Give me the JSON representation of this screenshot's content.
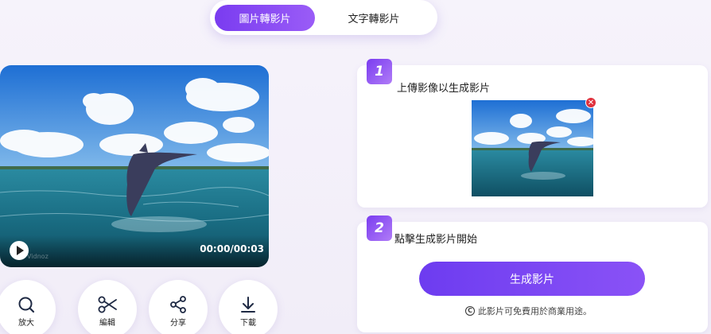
{
  "tabs": [
    {
      "label": "圖片轉影片",
      "active": true
    },
    {
      "label": "文字轉影片",
      "active": false
    }
  ],
  "video": {
    "timecode": "00:00/00:03",
    "watermark": "Vidnoz"
  },
  "actions": [
    {
      "label": "放大",
      "icon": "zoom-icon"
    },
    {
      "label": "編輯",
      "icon": "scissors-icon"
    },
    {
      "label": "分享",
      "icon": "share-icon"
    },
    {
      "label": "下載",
      "icon": "download-icon"
    }
  ],
  "step1": {
    "number": "1",
    "title": "上傳影像以生成影片",
    "remove_symbol": "✕"
  },
  "step2": {
    "number": "2",
    "title": "點擊生成影片開始",
    "button_label": "生成影片",
    "notice": "此影片可免費用於商業用途。",
    "copyright_symbol": "C"
  },
  "colors": {
    "accent": "#7a3cf0",
    "accent_light": "#9a5cf7",
    "remove": "#e0303c"
  }
}
